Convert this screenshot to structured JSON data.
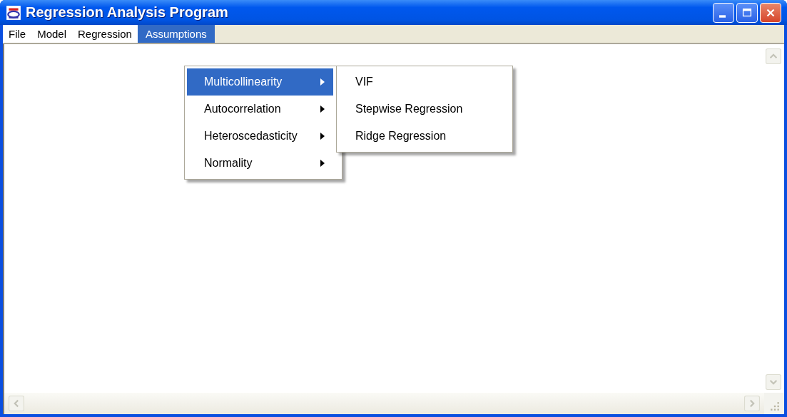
{
  "window": {
    "title": "Regression Analysis Program"
  },
  "menubar": [
    {
      "label": "File",
      "selected": false
    },
    {
      "label": "Model",
      "selected": false
    },
    {
      "label": "Regression",
      "selected": false
    },
    {
      "label": "Assumptions",
      "selected": true
    }
  ],
  "menu": [
    {
      "label": "Multicollinearity",
      "selected": true,
      "submenu": true
    },
    {
      "label": "Autocorrelation",
      "selected": false,
      "submenu": true
    },
    {
      "label": "Heteroscedasticity",
      "selected": false,
      "submenu": true
    },
    {
      "label": "Normality",
      "selected": false,
      "submenu": true
    }
  ],
  "submenu": [
    {
      "label": "VIF",
      "selected": false
    },
    {
      "label": "Stepwise Regression",
      "selected": false
    },
    {
      "label": "Ridge Regression",
      "selected": false
    }
  ]
}
